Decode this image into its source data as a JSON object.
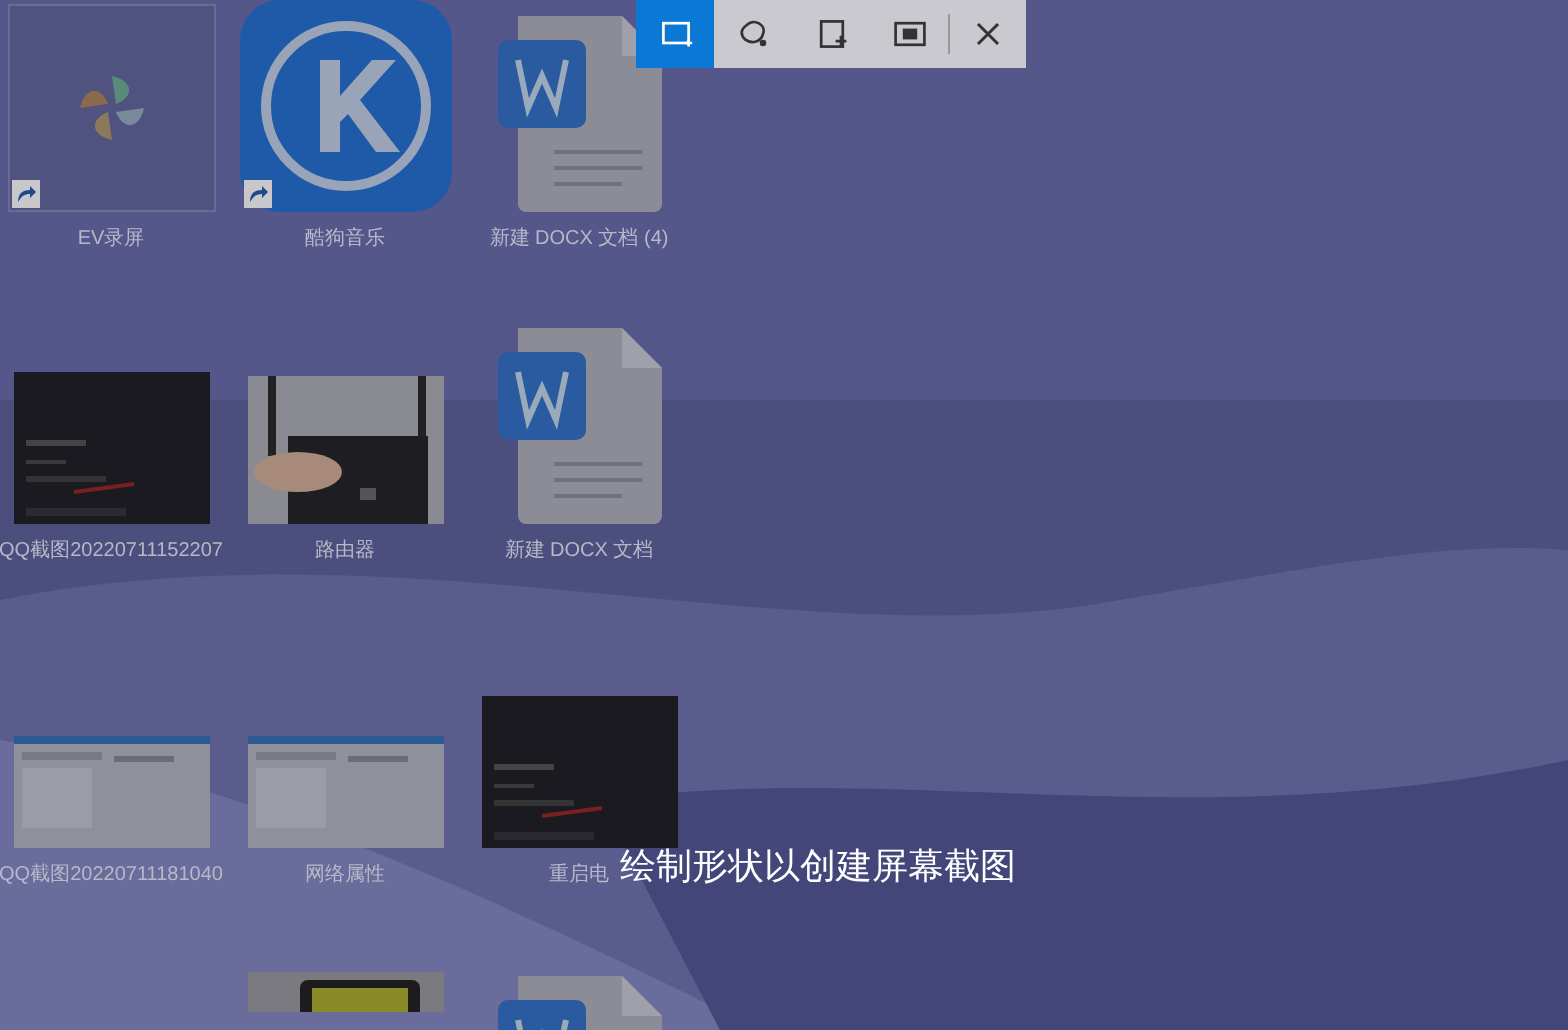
{
  "snip_toolbar": {
    "modes": [
      {
        "kind": "rectangle",
        "selected": true
      },
      {
        "kind": "freeform",
        "selected": false
      },
      {
        "kind": "window",
        "selected": false
      },
      {
        "kind": "fullscreen",
        "selected": false
      }
    ]
  },
  "desktop_icons": [
    {
      "kind": "app",
      "label": "EV录屏",
      "shortcut": true
    },
    {
      "kind": "kugou",
      "label": "酷狗音乐",
      "shortcut": true
    },
    {
      "kind": "docx",
      "label": "新建 DOCX 文档 (4)",
      "shortcut": false
    },
    {
      "kind": "dark-screen",
      "label": "QQ截图20220711152207",
      "shortcut": false
    },
    {
      "label": "路由器",
      "shortcut": false
    },
    {
      "kind": "docx",
      "label": "新建 DOCX 文档",
      "shortcut": false
    },
    {
      "kind": "light-screen",
      "label": "QQ截图20220711181040",
      "shortcut": false
    },
    {
      "kind": "light-screen",
      "label": "网络属性",
      "shortcut": false
    },
    {
      "kind": "dark-screen",
      "label": "重启电",
      "shortcut": false
    },
    {
      "kind": "yellow-photo",
      "shortcut": false
    },
    {
      "kind": "docx",
      "shortcut": false
    }
  ],
  "hint": "绘制形状以创建屏幕截图"
}
